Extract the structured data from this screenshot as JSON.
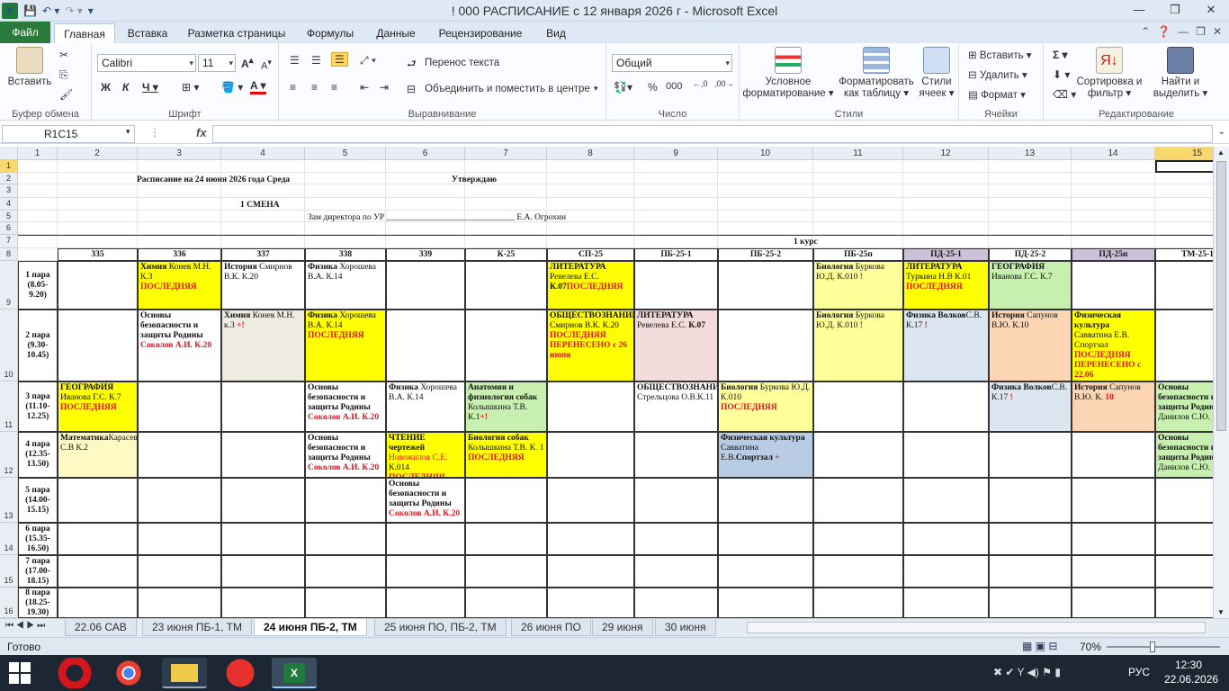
{
  "window": {
    "title": "! 000 РАСПИСАНИЕ с 12 января 2026 г  -  Microsoft Excel"
  },
  "ribbon_tabs": [
    "Файл",
    "Главная",
    "Вставка",
    "Разметка страницы",
    "Формулы",
    "Данные",
    "Рецензирование",
    "Вид"
  ],
  "ribbon": {
    "clipboard": {
      "paste": "Вставить",
      "label": "Буфер обмена"
    },
    "font": {
      "name": "Calibri",
      "size": "11",
      "label": "Шрифт"
    },
    "alignment": {
      "wrap": "Перенос текста",
      "merge": "Объединить и поместить в центре",
      "label": "Выравнивание"
    },
    "number": {
      "format": "Общий",
      "label": "Число"
    },
    "styles": {
      "cond": "Условное форматирование",
      "table": "Форматировать как таблицу",
      "cell": "Стили ячеек",
      "label": "Стили"
    },
    "cells": {
      "insert": "Вставить",
      "delete": "Удалить",
      "format": "Формат",
      "label": "Ячейки"
    },
    "editing": {
      "sort": "Сортировка и фильтр",
      "find": "Найти и выделить",
      "label": "Редактирование"
    }
  },
  "formula_bar": {
    "name_box": "R1C15",
    "fx": "fx",
    "value": ""
  },
  "columns": [
    "1",
    "2",
    "3",
    "4",
    "5",
    "6",
    "7",
    "8",
    "9",
    "10",
    "11",
    "12",
    "13",
    "14",
    "15"
  ],
  "rows": [
    "1",
    "2",
    "3",
    "4",
    "5",
    "6",
    "7",
    "8",
    "9",
    "10",
    "11",
    "12",
    "13",
    "14",
    "15",
    "16"
  ],
  "header_texts": {
    "title": "Расписание на 24 июня 2026 года  Среда",
    "approve": "Утверждаю",
    "shift": "1 СМЕНА",
    "director": "Зам директора по УР ______________________________ Е.А. Огрохин",
    "course": "1 курс"
  },
  "groups": [
    "335",
    "336",
    "337",
    "338",
    "339",
    "К-25",
    "СП-25",
    "ПБ-25-1",
    "ПБ-25-2",
    "ПБ-25п",
    "ПД-25-1",
    "ПД-25-2",
    "ПД-25п",
    "ТМ-25-1"
  ],
  "periods": [
    {
      "n": "1 пара",
      "t": "(8.05-",
      "t2": "9.20)"
    },
    {
      "n": "2 пара",
      "t": "(9.30-",
      "t2": "10.45)"
    },
    {
      "n": "3 пара",
      "t": "(11.10-",
      "t2": "12.25)"
    },
    {
      "n": "4 пара",
      "t": "(12.35-",
      "t2": "13.50)"
    },
    {
      "n": "5 пара",
      "t": "(14.00-",
      "t2": "15.15)"
    },
    {
      "n": "6 пара",
      "t": "(15.35-",
      "t2": "16.50)"
    },
    {
      "n": "7 пара",
      "t": "(17.00-",
      "t2": "18.15)"
    },
    {
      "n": "8 пара",
      "t": "(18.25-",
      "t2": "19.30)"
    }
  ],
  "cells": {
    "r9c3": {
      "a": "Химия",
      "b": " Конев М.Н. К.3 ",
      "c": "ПОСЛЕДНЯЯ"
    },
    "r9c4": {
      "a": "История",
      "b": " Смирнов В.К. К.20"
    },
    "r9c5": {
      "a": "Физика",
      "b": " Хорошева В.А. К.14"
    },
    "r9c8": {
      "a": "ЛИТЕРАТУРА",
      "b": "Ревелева Е.С. ",
      "k": "К.07",
      "c": "ПОСЛЕДНЯЯ"
    },
    "r9c11": {
      "a": "Биология",
      "b": " Буркова Ю.Д. К.010 ",
      "c": "!"
    },
    "r9c12": {
      "a": "ЛИТЕРАТУРА",
      "b": "Туркина Н.В К.01",
      "c": "ПОСЛЕДНЯЯ"
    },
    "r9c13": {
      "a": "ГЕОГРАФИЯ",
      "b": "Иванова Г.С. К.7"
    },
    "r10c3": {
      "a": "Основы безопасности и защиты Родины",
      "c": "Соколов А.И. К.20"
    },
    "r10c4": {
      "a": "Химия",
      "b": " Конев М.Н. к.3 ",
      "c": "+!"
    },
    "r10c5": {
      "a": "Физика",
      "b": " Хорошева В.А. К.14",
      "c": "ПОСЛЕДНЯЯ"
    },
    "r10c8": {
      "a": "ОБЩЕСТВОЗНАНИЕ",
      "b": "Смирнов В.К. К.20",
      "c": "ПОСЛЕДНЯЯ ПЕРЕНЕСЕНО с 26 июня"
    },
    "r10c9": {
      "a": "ЛИТЕРАТУРА",
      "b": "Ревелева Е.С. ",
      "k": "К.07"
    },
    "r10c11": {
      "a": "Биология",
      "b": " Буркова Ю.Д. К.010 ",
      "c": "!"
    },
    "r10c12": {
      "a": "Физика   Волков",
      "b": "С.В. К.17 ",
      "c": "!"
    },
    "r10c13": {
      "a": "История",
      "b": " Сапунов В.Ю. К.10"
    },
    "r10c14": {
      "a": "Физическая культура",
      "b": " Савватина Е.В. Спортзал",
      "c": "ПОСЛЕДНЯЯ ПЕРЕНЕСЕНО с 22.06"
    },
    "r11c2": {
      "a": "ГЕОГРАФИЯ",
      "b": "Иванова Г.С. К.7",
      "c": "ПОСЛЕДНЯЯ"
    },
    "r11c5": {
      "a": "Основы безопасности и защиты Родины",
      "c": "Соколов А.И. К.20"
    },
    "r11c6": {
      "a": "Физика",
      "b": " Хорошева В.А. К.14"
    },
    "r11c7": {
      "a": "Анатомия и физиология собак",
      "b": "Колышкина Т.В. К.1",
      "c": "+!"
    },
    "r11c9": {
      "a": "ОБЩЕСТВОЗНАНИЕ",
      "b": "Стрельцова О.В.К.11"
    },
    "r11c10": {
      "a": "Биология",
      "b": " Буркова Ю.Д. К.010 ",
      "c": "ПОСЛЕДНЯЯ"
    },
    "r11c13": {
      "a": "Физика   Волков",
      "b": "С.В. К.17 ",
      "c": "!"
    },
    "r11c14": {
      "a": "История",
      "b": " Сапунов В.Ю. К. ",
      "c": "10"
    },
    "r11c15": {
      "a": "Основы безопасности и защиты Родины",
      "b": "Данилов С.Ю. К"
    },
    "r12c2": {
      "a": "Математика",
      "b": "Карасева С.В К.2"
    },
    "r12c5": {
      "a": "Основы безопасности и защиты Родины",
      "c": "Соколов А.И. К.20"
    },
    "r12c6": {
      "a": "ЧТЕНИЕ чертежей",
      "d": "Новожилов С.Е. ",
      "b": "К.014",
      "c": "ПОСЛЕДНЯЯ"
    },
    "r12c7": {
      "a": "Биология собак",
      "b": "Колышкина Т.В. К. 1",
      "c": "ПОСЛЕДНЯЯ"
    },
    "r12c10": {
      "a": "Физическая культура",
      "b": "Савватина Е.В.",
      "k": "Спортзал",
      "c": " +"
    },
    "r12c15": {
      "a": "Основы безопасности и защиты Родины",
      "b": "Данилов С.Ю. К"
    },
    "r13c6": {
      "a": "Основы безопасности и защиты Родины",
      "c": "Соколов А.И. К.20"
    }
  },
  "sheet_tabs": [
    "22.06 САВ",
    "23 июня ПБ-1, ТМ",
    "24 июня ПБ-2, ТМ",
    "25 июня ПО, ПБ-2, ТМ",
    "26 июня ПО",
    "29 июня",
    "30 июня"
  ],
  "status": {
    "ready": "Готово",
    "zoom": "70%"
  },
  "taskbar": {
    "lang": "РУС",
    "time": "12:30",
    "date": "22.06.2026"
  },
  "colors": {
    "yellow": "#ffff00",
    "lightyellow": "#ffff99",
    "green": "#c6efb0",
    "pink": "#f2dcdb",
    "blue": "#dce6f1",
    "peach": "#fcd5b4",
    "khaki": "#eeece1",
    "steel": "#b8cce4",
    "lavender": "#ccc0da",
    "cream": "#fff9c4"
  }
}
